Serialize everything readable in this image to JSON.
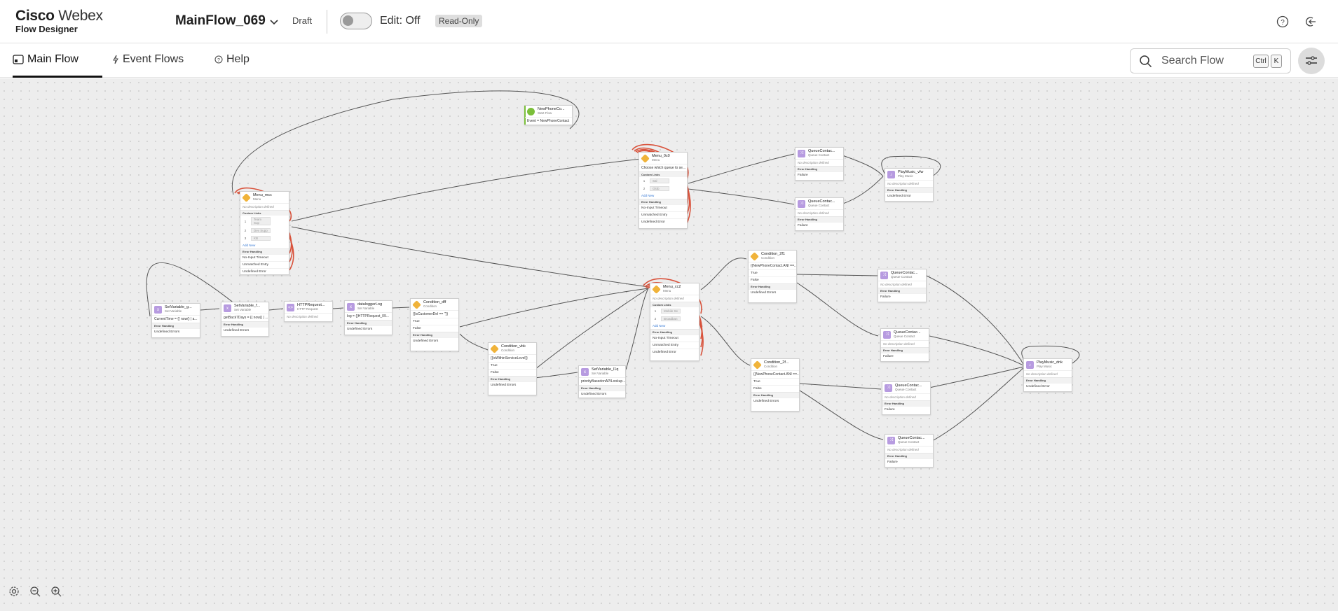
{
  "app": {
    "brand_cisco": "Cisco",
    "brand_webex": "Webex",
    "product": "Flow Designer"
  },
  "header": {
    "flow_name": "MainFlow_069",
    "status": "Draft",
    "edit_label": "Edit: Off",
    "badge": "Read-Only",
    "icons": [
      "help-circle-icon",
      "sign-out-icon"
    ]
  },
  "tabs": [
    {
      "label": "Main Flow",
      "icon": "flow-icon",
      "active": true
    },
    {
      "label": "Event Flows",
      "icon": "lightning-icon",
      "active": false
    },
    {
      "label": "Help",
      "icon": "help-circle-icon",
      "active": false
    }
  ],
  "search": {
    "placeholder": "Search Flow",
    "key1": "Ctrl",
    "key2": "K"
  },
  "nodes": {
    "start": {
      "title": "NewPhoneCo...",
      "type": "Start Flow",
      "body": "Event = NewPhoneContact"
    },
    "menu_main": {
      "title": "Menu_mcc",
      "type": "Menu",
      "desc": "No description defined",
      "section_links": "Custom Links",
      "items": [
        {
          "k": "1",
          "v": "Team Sup"
        },
        {
          "k": "2",
          "v": "Dev Supp"
        },
        {
          "k": "3",
          "v": "KB"
        }
      ],
      "add": "Add New",
      "section_err": "Error Handling",
      "errs": [
        "No-Input Timeout",
        "Unmatched Entry",
        "Undefined Error"
      ]
    },
    "menu_0c0": {
      "title": "Menu_0c0",
      "type": "Menu",
      "body": "Choose which queue to se...",
      "section_links": "Custom Links",
      "items": [
        {
          "k": "1",
          "v": "Sal"
        },
        {
          "k": "2",
          "v": "Glob"
        }
      ],
      "add": "Add New",
      "section_err": "Error Handling",
      "errs": [
        "No-Input Timeout",
        "Unmatched Entry",
        "Undefined Error"
      ]
    },
    "menu_2": {
      "title": "Menu_cc2",
      "type": "Menu",
      "desc": "No description defined",
      "section_links": "Custom Links",
      "items": [
        {
          "k": "1",
          "v": "Mobile Se"
        },
        {
          "k": "2",
          "v": "Broadban"
        }
      ],
      "add": "Add New",
      "section_err": "Error Handling",
      "errs": [
        "No-Input Timeout",
        "Unmatched Entry",
        "Undefined Error"
      ]
    },
    "setvar1": {
      "title": "SetVariable_g...",
      "type": "Set Variable",
      "body": "CurrentTime = {{ now() | a...",
      "section_err": "Error Handling",
      "errs": [
        "Undefined Errors"
      ]
    },
    "setvar2": {
      "title": "SetVariable_f...",
      "type": "Set Variable",
      "body": "getBack7Days = {{ now() | ...",
      "section_err": "Error Handling",
      "errs": [
        "Undefined Errors"
      ]
    },
    "http": {
      "title": "HTTPRequest...",
      "type": "HTTP Request",
      "desc": "No description defined"
    },
    "parse": {
      "title": "dataloggerLog",
      "type": "Set Variable",
      "body": "log = {{HTTPRequest_09...",
      "section_err": "Error Handling",
      "errs": [
        "Undefined Errors"
      ]
    },
    "cond1": {
      "title": "Condition_dff",
      "type": "Condition",
      "body": "{{isCustomerDel == ''}}",
      "rows": [
        "True",
        "False"
      ],
      "section_err": "Error Handling",
      "errs": [
        "Undefined Errors"
      ]
    },
    "cond2": {
      "title": "Condition_vbk",
      "type": "Condition",
      "body": "{{isWithinServiceLevel}}",
      "rows": [
        "True",
        "False"
      ],
      "section_err": "Error Handling",
      "errs": [
        "Undefined Errors"
      ]
    },
    "setvar3": {
      "title": "SetVariable_l1q",
      "type": "Set Variable",
      "body": "priorityBasedonAPILookup...",
      "section_err": "Error Handling",
      "errs": [
        "Undefined Errors"
      ]
    },
    "cond3": {
      "title": "Condition_2f1",
      "type": "Condition",
      "body": "{{NewPhoneContact.ANI ==...",
      "rows": [
        "True",
        "False"
      ],
      "section_err": "Error Handling",
      "errs": [
        "Undefined Errors"
      ]
    },
    "cond4": {
      "title": "Condition_2f...",
      "type": "Condition",
      "body": "{{NewPhoneContact.ANI ==...",
      "rows": [
        "True",
        "False"
      ],
      "section_err": "Error Handling",
      "errs": [
        "Undefined Errors"
      ]
    },
    "q1": {
      "title": "QueueContac...",
      "type": "Queue Contact",
      "desc": "No description defined",
      "section_err": "Error Handling",
      "errs": [
        "Failure"
      ]
    },
    "q2": {
      "title": "QueueContac...",
      "type": "Queue Contact",
      "desc": "No description defined",
      "section_err": "Error Handling",
      "errs": [
        "Failure"
      ]
    },
    "q3": {
      "title": "QueueContac...",
      "type": "Queue Contact",
      "desc": "No description defined",
      "section_err": "Error Handling",
      "errs": [
        "Failure"
      ]
    },
    "q4": {
      "title": "QueueContac...",
      "type": "Queue Contact",
      "desc": "No description defined",
      "section_err": "Error Handling",
      "errs": [
        "Failure"
      ]
    },
    "q5": {
      "title": "QueueContac...",
      "type": "Queue Contact",
      "desc": "No description defined",
      "section_err": "Error Handling",
      "errs": [
        "Failure"
      ]
    },
    "q6": {
      "title": "QueueContac...",
      "type": "Queue Contact",
      "desc": "No description defined",
      "section_err": "Error Handling",
      "errs": [
        "Failure"
      ]
    },
    "pm1": {
      "title": "PlayMusic_vfw",
      "type": "Play Music",
      "desc": "No description defined",
      "section_err": "Error Handling",
      "errs": [
        "Undefined Error"
      ]
    },
    "pm2": {
      "title": "PlayMusic_dnk",
      "type": "Play Music",
      "desc": "No description defined",
      "section_err": "Error Handling",
      "errs": [
        "Undefined Error"
      ]
    }
  },
  "canvas_controls": [
    "settings-icon",
    "zoom-out-icon",
    "zoom-in-icon"
  ],
  "colors": {
    "accent_orange": "#f0b33a",
    "accent_purple": "#b79be0",
    "start_green": "#7bbf3a",
    "error_edge": "#d9533c"
  }
}
